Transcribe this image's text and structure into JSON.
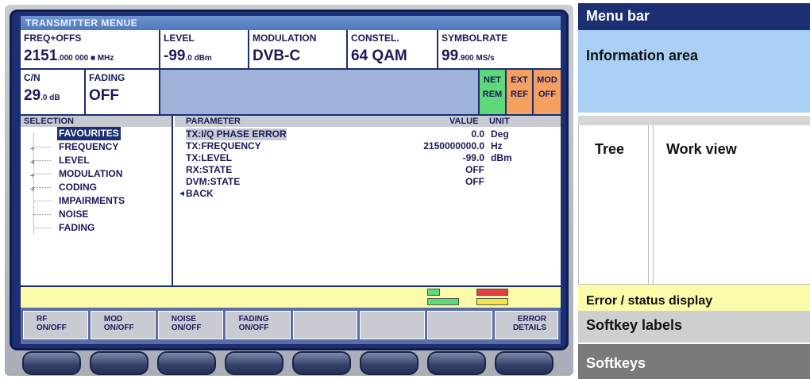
{
  "screen": {
    "menu_title": "TRANSMITTER MENUE",
    "info": {
      "freq": {
        "label": "FREQ+OFFS",
        "value": "2151",
        "value_small": ".000 000 ■ MHz"
      },
      "level": {
        "label": "LEVEL",
        "value": "-99",
        "value_small": ".0 dBm"
      },
      "modulation": {
        "label": "MODULATION",
        "value": "DVB-C"
      },
      "constel": {
        "label": "CONSTEL.",
        "value": "64 QAM"
      },
      "symbolrate": {
        "label": "SYMBOLRATE",
        "value": "99",
        "value_small": ".900 MS/s"
      },
      "cn": {
        "label": "C/N",
        "value": "29",
        "value_small": ".0 dB"
      },
      "fading": {
        "label": "FADING",
        "value": "OFF"
      },
      "status_tiles": [
        {
          "top": "NET",
          "bottom": "REM",
          "color": "#5fd87a"
        },
        {
          "top": "EXT",
          "bottom": "REF",
          "color": "#f3a060"
        },
        {
          "top": "MOD",
          "bottom": "OFF",
          "color": "#f3a060"
        }
      ]
    },
    "tree": {
      "header": "SELECTION",
      "items": [
        {
          "label": "FAVOURITES",
          "selected": true,
          "expand": false
        },
        {
          "label": "FREQUENCY",
          "selected": false,
          "expand": true
        },
        {
          "label": "LEVEL",
          "selected": false,
          "expand": true
        },
        {
          "label": "MODULATION",
          "selected": false,
          "expand": true
        },
        {
          "label": "CODING",
          "selected": false,
          "expand": true
        },
        {
          "label": "IMPAIRMENTS",
          "selected": false,
          "expand": false
        },
        {
          "label": "NOISE",
          "selected": false,
          "expand": false
        },
        {
          "label": "FADING",
          "selected": false,
          "expand": false
        }
      ]
    },
    "work": {
      "headers": {
        "parameter": "PARAMETER",
        "value": "VALUE",
        "unit": "UNIT"
      },
      "rows": [
        {
          "parameter": "TX:I/Q PHASE ERROR",
          "value": "0.0",
          "unit": "Deg",
          "highlight": true
        },
        {
          "parameter": "TX:FREQUENCY",
          "value": "2150000000.0",
          "unit": "Hz",
          "highlight": false
        },
        {
          "parameter": "TX:LEVEL",
          "value": "-99.0",
          "unit": "dBm",
          "highlight": false
        },
        {
          "parameter": "RX:STATE",
          "value": "OFF",
          "unit": "",
          "highlight": false
        },
        {
          "parameter": "DVM:STATE",
          "value": "OFF",
          "unit": "",
          "highlight": false
        },
        {
          "parameter": "BACK",
          "value": "",
          "unit": "",
          "highlight": false
        }
      ]
    },
    "softkeys": [
      {
        "line1": "RF",
        "line2": "ON/OFF"
      },
      {
        "line1": "MOD",
        "line2": "ON/OFF"
      },
      {
        "line1": "NOISE",
        "line2": "ON/OFF"
      },
      {
        "line1": "FADING",
        "line2": "ON/OFF"
      },
      {
        "line1": "",
        "line2": ""
      },
      {
        "line1": "",
        "line2": ""
      },
      {
        "line1": "",
        "line2": ""
      },
      {
        "line1": "ERROR",
        "line2": "DETAILS"
      }
    ]
  },
  "legend": {
    "menu_bar": "Menu bar",
    "information_area": "Information area",
    "tree": "Tree",
    "work_view": "Work view",
    "error_status": "Error / status display",
    "softkey_labels": "Softkey labels",
    "softkeys": "Softkeys"
  },
  "colors": {
    "bezel": "#1c2f73",
    "legend_menu": "#1c2f73",
    "legend_info": "#a9cff4",
    "legend_error": "#fbfbaa",
    "legend_softkey_labels": "#cfcfcf",
    "legend_softkeys": "#7a7a7a"
  }
}
